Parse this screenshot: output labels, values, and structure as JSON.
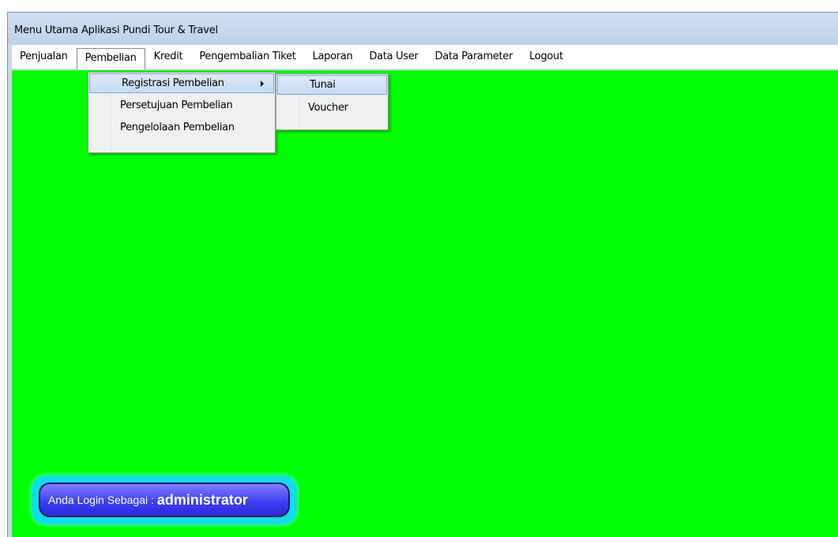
{
  "window": {
    "title": "Menu Utama Aplikasi Pundi Tour & Travel"
  },
  "menubar": {
    "items": [
      {
        "label": "Penjualan"
      },
      {
        "label": "Pembelian"
      },
      {
        "label": "Kredit"
      },
      {
        "label": "Pengembalian Tiket"
      },
      {
        "label": "Laporan"
      },
      {
        "label": "Data User"
      },
      {
        "label": "Data Parameter"
      },
      {
        "label": "Logout"
      }
    ]
  },
  "pembelian_menu": {
    "items": [
      {
        "label": "Registrasi Pembelian"
      },
      {
        "label": "Persetujuan Pembelian"
      },
      {
        "label": "Pengelolaan Pembelian"
      }
    ]
  },
  "registrasi_submenu": {
    "items": [
      {
        "label": "Tunai"
      },
      {
        "label": "Voucher"
      }
    ]
  },
  "login": {
    "label": "Anda Login Sebagai :",
    "user": "administrator"
  },
  "colors": {
    "client_background": "#00ff00",
    "menu_highlight": "#c4dbf5",
    "badge_outer": "#0fdcea",
    "badge_inner": "#3b3bf2"
  }
}
